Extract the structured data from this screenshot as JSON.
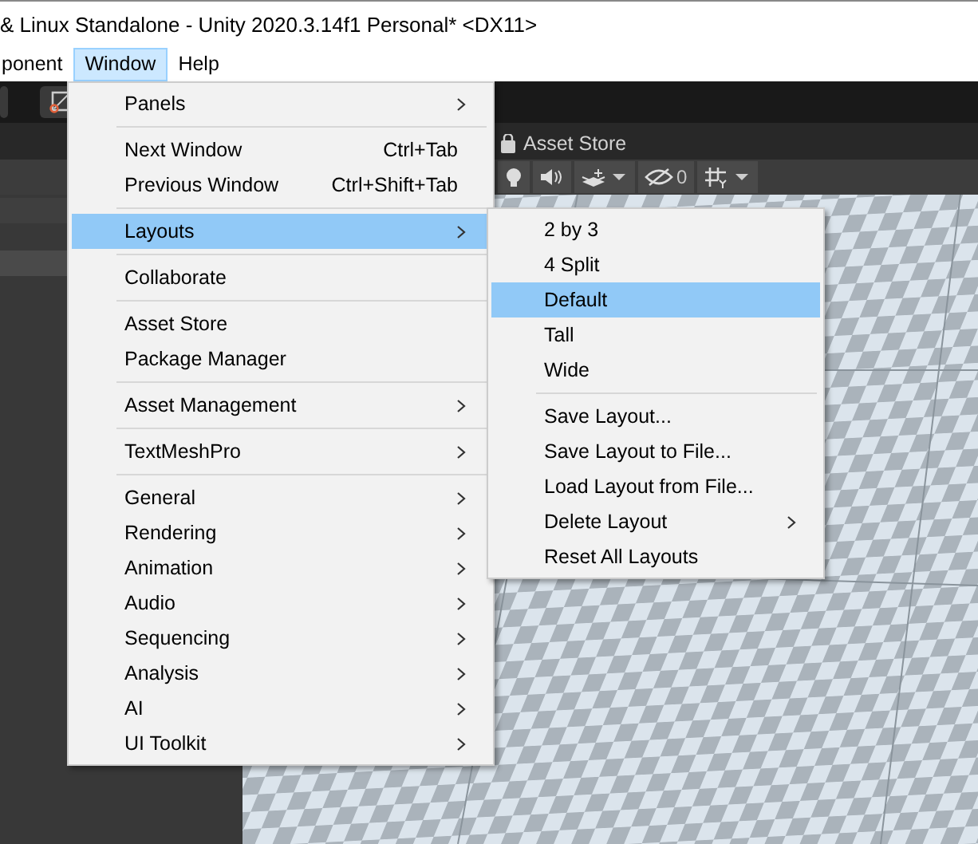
{
  "window": {
    "title": "& Linux Standalone - Unity 2020.3.14f1 Personal* <DX11>"
  },
  "menubar": [
    {
      "label": "ponent",
      "selected": false
    },
    {
      "label": "Window",
      "selected": true
    },
    {
      "label": "Help",
      "selected": false
    }
  ],
  "asset_store_tab": {
    "label": "Asset Store"
  },
  "scene_toolbar": {
    "hidden_count": "0"
  },
  "window_menu": [
    {
      "kind": "item",
      "label": "Panels",
      "submenu": true,
      "selected": false
    },
    {
      "kind": "separator"
    },
    {
      "kind": "item",
      "label": "Next Window",
      "shortcut": "Ctrl+Tab",
      "submenu": false,
      "selected": false
    },
    {
      "kind": "item",
      "label": "Previous Window",
      "shortcut": "Ctrl+Shift+Tab",
      "submenu": false,
      "selected": false
    },
    {
      "kind": "separator"
    },
    {
      "kind": "item",
      "label": "Layouts",
      "submenu": true,
      "selected": true
    },
    {
      "kind": "separator"
    },
    {
      "kind": "item",
      "label": "Collaborate",
      "submenu": false,
      "selected": false
    },
    {
      "kind": "separator"
    },
    {
      "kind": "item",
      "label": "Asset Store",
      "submenu": false,
      "selected": false
    },
    {
      "kind": "item",
      "label": "Package Manager",
      "submenu": false,
      "selected": false
    },
    {
      "kind": "separator"
    },
    {
      "kind": "item",
      "label": "Asset Management",
      "submenu": true,
      "selected": false
    },
    {
      "kind": "separator"
    },
    {
      "kind": "item",
      "label": "TextMeshPro",
      "submenu": true,
      "selected": false
    },
    {
      "kind": "separator"
    },
    {
      "kind": "item",
      "label": "General",
      "submenu": true,
      "selected": false
    },
    {
      "kind": "item",
      "label": "Rendering",
      "submenu": true,
      "selected": false
    },
    {
      "kind": "item",
      "label": "Animation",
      "submenu": true,
      "selected": false
    },
    {
      "kind": "item",
      "label": "Audio",
      "submenu": true,
      "selected": false
    },
    {
      "kind": "item",
      "label": "Sequencing",
      "submenu": true,
      "selected": false
    },
    {
      "kind": "item",
      "label": "Analysis",
      "submenu": true,
      "selected": false
    },
    {
      "kind": "item",
      "label": "AI",
      "submenu": true,
      "selected": false
    },
    {
      "kind": "item",
      "label": "UI Toolkit",
      "submenu": true,
      "selected": false
    }
  ],
  "layouts_submenu": [
    {
      "kind": "item",
      "label": "2 by 3",
      "submenu": false,
      "selected": false
    },
    {
      "kind": "item",
      "label": "4 Split",
      "submenu": false,
      "selected": false
    },
    {
      "kind": "item",
      "label": "Default",
      "submenu": false,
      "selected": true
    },
    {
      "kind": "item",
      "label": "Tall",
      "submenu": false,
      "selected": false
    },
    {
      "kind": "item",
      "label": "Wide",
      "submenu": false,
      "selected": false
    },
    {
      "kind": "separator"
    },
    {
      "kind": "item",
      "label": "Save Layout...",
      "submenu": false,
      "selected": false
    },
    {
      "kind": "item",
      "label": "Save Layout to File...",
      "submenu": false,
      "selected": false
    },
    {
      "kind": "item",
      "label": "Load Layout from File...",
      "submenu": false,
      "selected": false
    },
    {
      "kind": "item",
      "label": "Delete Layout",
      "submenu": true,
      "selected": false
    },
    {
      "kind": "item",
      "label": "Reset All Layouts",
      "submenu": false,
      "selected": false
    }
  ]
}
